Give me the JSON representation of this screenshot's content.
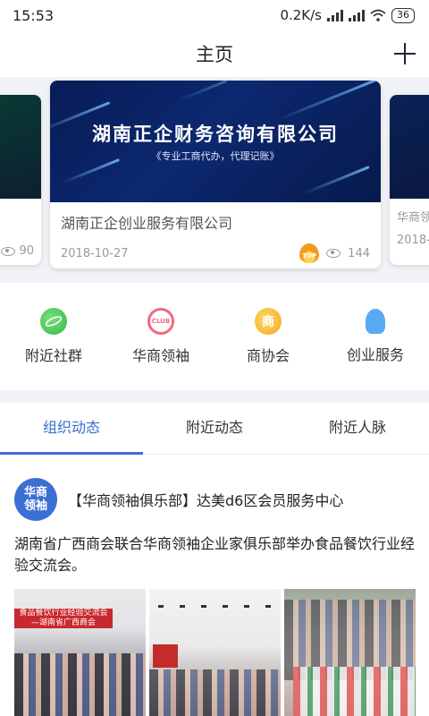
{
  "status": {
    "time": "15:53",
    "speed": "0.2K/s",
    "battery": "36"
  },
  "header": {
    "title": "主页"
  },
  "carousel": {
    "main": {
      "banner_title": "湖南正企财务咨询有限公司",
      "banner_subtitle": "《专业工商代办，代理记账》",
      "title": "湖南正企创业服务有限公司",
      "date": "2018-10-27",
      "hot_badge": "TOP",
      "views": "144"
    },
    "left": {
      "views": "90"
    },
    "right": {
      "title": "华商领",
      "date": "2018-1"
    }
  },
  "features": [
    {
      "label": "附近社群",
      "icon": "planet-icon"
    },
    {
      "label": "华商领袖",
      "icon_text": "CLUB",
      "icon": "club-icon"
    },
    {
      "label": "商协会",
      "icon_text": "商",
      "icon": "chamber-icon"
    },
    {
      "label": "创业服务",
      "icon": "lightbulb-icon"
    }
  ],
  "tabs": [
    {
      "label": "组织动态",
      "active": true
    },
    {
      "label": "附近动态",
      "active": false
    },
    {
      "label": "附近人脉",
      "active": false
    }
  ],
  "feed": {
    "avatar_line1": "华商",
    "avatar_line2": "领袖",
    "source": "【华商领袖俱乐部】达美d6区会员服务中心",
    "text": "湖南省广西商会联合华商领袖企业家俱乐部举办食品餐饮行业经验交流会。",
    "photo1_banner": "食品餐饮行业经验交流会",
    "photo1_banner_sub": "—湖南省广西商会"
  },
  "colors": {
    "accent": "#3a6fd1",
    "banner_bg": "#0c2870"
  }
}
